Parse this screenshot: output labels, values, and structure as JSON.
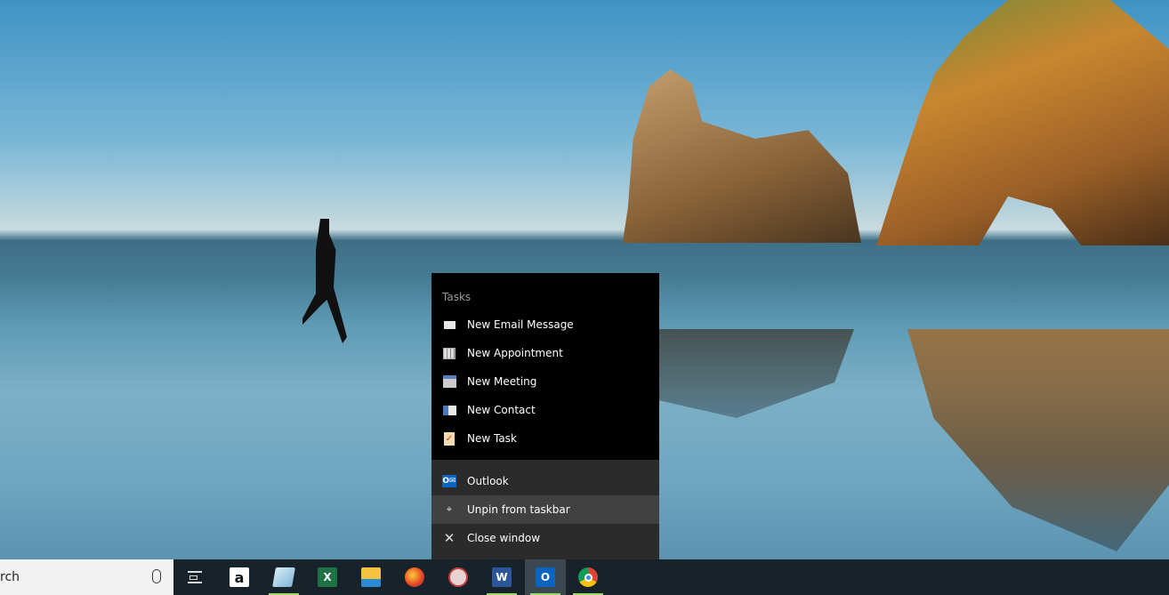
{
  "jump_list": {
    "section_title": "Tasks",
    "tasks": [
      {
        "label": "New Email Message",
        "icon": "envelope-icon"
      },
      {
        "label": "New Appointment",
        "icon": "calendar-icon"
      },
      {
        "label": "New Meeting",
        "icon": "meeting-icon"
      },
      {
        "label": "New Contact",
        "icon": "contact-card-icon"
      },
      {
        "label": "New Task",
        "icon": "clipboard-task-icon"
      }
    ],
    "actions": [
      {
        "label": "Outlook",
        "icon": "outlook-icon"
      },
      {
        "label": "Unpin from taskbar",
        "icon": "unpin-icon"
      },
      {
        "label": "Close window",
        "icon": "close-icon"
      }
    ]
  },
  "taskbar": {
    "search_text": "rch",
    "apps": [
      {
        "name": "Task View",
        "icon": "task-view-icon"
      },
      {
        "name": "Amazon",
        "icon": "amazon-icon",
        "glyph": "a"
      },
      {
        "name": "Notepad",
        "icon": "notepad-icon",
        "running": true
      },
      {
        "name": "Excel",
        "icon": "excel-icon",
        "glyph": "X"
      },
      {
        "name": "File Explorer",
        "icon": "folder-icon"
      },
      {
        "name": "Firefox",
        "icon": "firefox-icon"
      },
      {
        "name": "Snipping Tool",
        "icon": "snipping-tool-icon"
      },
      {
        "name": "Word",
        "icon": "word-icon",
        "glyph": "W",
        "running": true
      },
      {
        "name": "Outlook",
        "icon": "outlook-icon",
        "glyph": "O",
        "running": true,
        "active": true
      },
      {
        "name": "Chrome",
        "icon": "chrome-icon",
        "running": true
      }
    ]
  },
  "colors": {
    "running_indicator": "#9fd66a",
    "menu_bg": "#000000",
    "menu_bottom_bg": "#2b2b2b",
    "taskbar_bg": "#18222a"
  }
}
